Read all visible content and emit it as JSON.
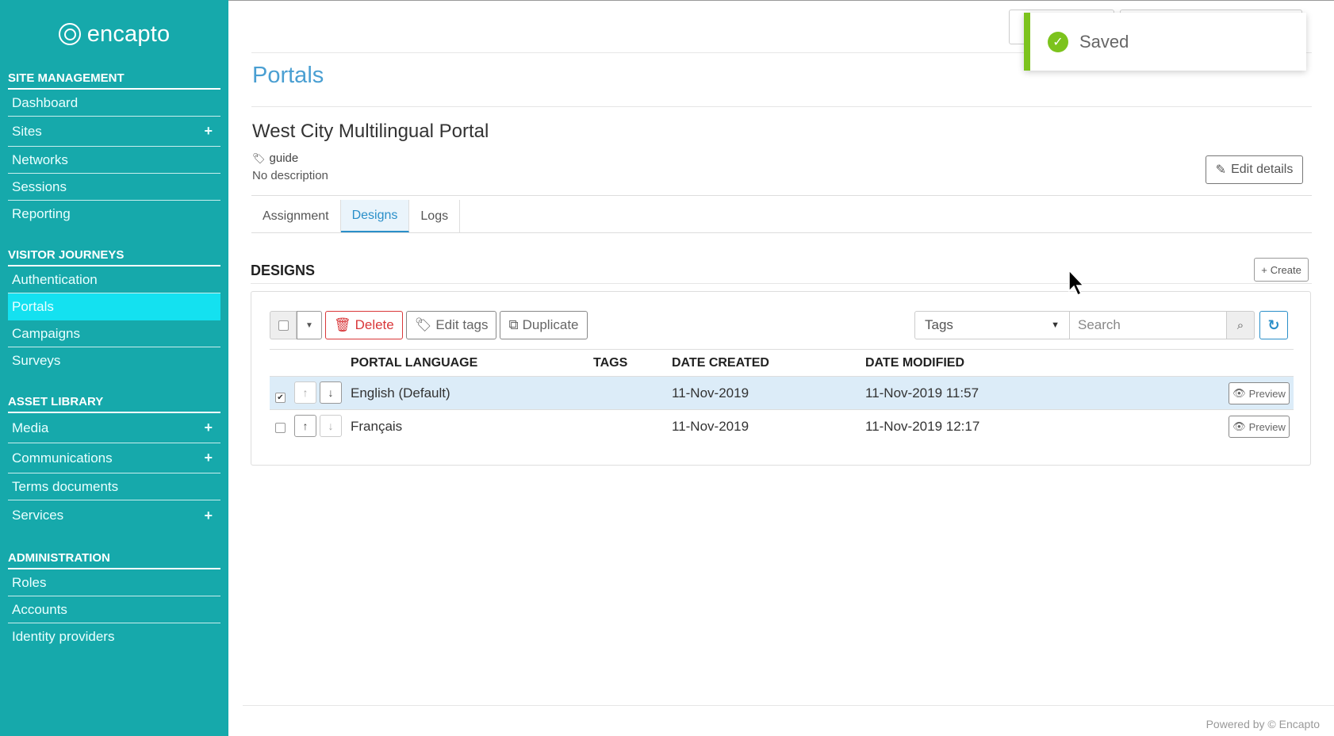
{
  "brand": {
    "name": "encapto"
  },
  "sidebar": {
    "sections": [
      {
        "title": "SITE MANAGEMENT",
        "items": [
          {
            "label": "Dashboard",
            "plus": false
          },
          {
            "label": "Sites",
            "plus": true
          },
          {
            "label": "Networks",
            "plus": false
          },
          {
            "label": "Sessions",
            "plus": false
          },
          {
            "label": "Reporting",
            "plus": false
          }
        ]
      },
      {
        "title": "VISITOR JOURNEYS",
        "items": [
          {
            "label": "Authentication",
            "plus": false
          },
          {
            "label": "Portals",
            "plus": false,
            "active": true
          },
          {
            "label": "Campaigns",
            "plus": false
          },
          {
            "label": "Surveys",
            "plus": false
          }
        ]
      },
      {
        "title": "ASSET LIBRARY",
        "items": [
          {
            "label": "Media",
            "plus": true
          },
          {
            "label": "Communications",
            "plus": true
          },
          {
            "label": "Terms documents",
            "plus": false
          },
          {
            "label": "Services",
            "plus": true
          }
        ]
      },
      {
        "title": "ADMINISTRATION",
        "items": [
          {
            "label": "Roles",
            "plus": false
          },
          {
            "label": "Accounts",
            "plus": false
          },
          {
            "label": "Identity providers",
            "plus": false
          }
        ]
      }
    ]
  },
  "toast": {
    "message": "Saved"
  },
  "page": {
    "title": "Portals"
  },
  "portal": {
    "name": "West City Multilingual Portal",
    "tag": "guide",
    "description": "No description",
    "edit_label": "Edit details"
  },
  "tabs": [
    {
      "label": "Assignment"
    },
    {
      "label": "Designs",
      "active": true
    },
    {
      "label": "Logs"
    }
  ],
  "designs": {
    "title": "DESIGNS",
    "create_label": "Create",
    "toolbar": {
      "delete_label": "Delete",
      "edit_tags_label": "Edit tags",
      "duplicate_label": "Duplicate",
      "tags_select": "Tags",
      "search_placeholder": "Search"
    },
    "columns": {
      "language": "PORTAL LANGUAGE",
      "tags": "TAGS",
      "created": "DATE CREATED",
      "modified": "DATE MODIFIED"
    },
    "rows": [
      {
        "language": "English (Default)",
        "tags": "",
        "created": "11-Nov-2019",
        "modified": "11-Nov-2019 11:57",
        "checked": true,
        "preview": "Preview"
      },
      {
        "language": "Français",
        "tags": "",
        "created": "11-Nov-2019",
        "modified": "11-Nov-2019 12:17",
        "checked": false,
        "preview": "Preview"
      }
    ]
  },
  "footer": {
    "text": "Powered by © Encapto"
  },
  "colors": {
    "sidebar": "#16a9ab",
    "active_nav": "#14e1f0",
    "accent": "#2a8fc9",
    "success": "#7cc31d",
    "danger": "#d9383a"
  }
}
